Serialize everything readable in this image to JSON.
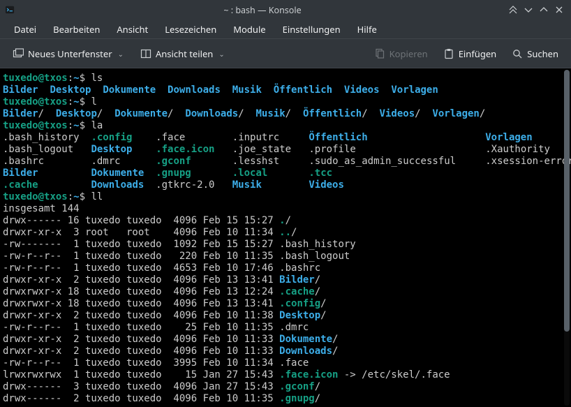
{
  "window": {
    "title": "~ : bash — Konsole"
  },
  "menubar": {
    "items": [
      "Datei",
      "Bearbeiten",
      "Ansicht",
      "Lesezeichen",
      "Module",
      "Einstellungen",
      "Hilfe"
    ]
  },
  "toolbar": {
    "new_tab": "Neues Unterfenster",
    "split_view": "Ansicht teilen",
    "copy": "Kopieren",
    "paste": "Einfügen",
    "search": "Suchen"
  },
  "prompt": {
    "user": "tuxedo",
    "host": "txos",
    "sep": "@",
    "colon": ":",
    "path": "~",
    "dollar": "$ "
  },
  "cmds": {
    "ls": "ls",
    "l": "l",
    "la": "la",
    "ll": "ll"
  },
  "ls_out": [
    "Bilder",
    "Desktop",
    "Dokumente",
    "Downloads",
    "Musik",
    "Öffentlich",
    "Videos",
    "Vorlagen"
  ],
  "l_out": [
    "Bilder",
    "Desktop",
    "Dokumente",
    "Downloads",
    "Musik",
    "Öffentlich",
    "Videos",
    "Vorlagen"
  ],
  "la_grid": {
    "rows": [
      [
        {
          "t": ".bash_history",
          "c": "pl"
        },
        {
          "t": ".config",
          "c": "hidd"
        },
        {
          "t": ".face",
          "c": "pl"
        },
        {
          "t": ".inputrc",
          "c": "pl"
        },
        {
          "t": "Öffentlich",
          "c": "dir"
        },
        {
          "t": "Vorlagen",
          "c": "dir"
        }
      ],
      [
        {
          "t": ".bash_logout",
          "c": "pl"
        },
        {
          "t": "Desktop",
          "c": "dir"
        },
        {
          "t": ".face.icon",
          "c": "hidd"
        },
        {
          "t": ".joe_state",
          "c": "pl"
        },
        {
          "t": ".profile",
          "c": "pl"
        },
        {
          "t": ".Xauthority",
          "c": "pl"
        }
      ],
      [
        {
          "t": ".bashrc",
          "c": "pl"
        },
        {
          "t": ".dmrc",
          "c": "pl"
        },
        {
          "t": ".gconf",
          "c": "hidd"
        },
        {
          "t": ".lesshst",
          "c": "pl"
        },
        {
          "t": ".sudo_as_admin_successful",
          "c": "pl"
        },
        {
          "t": ".xsession-errors",
          "c": "pl"
        }
      ],
      [
        {
          "t": "Bilder",
          "c": "dir"
        },
        {
          "t": "Dokumente",
          "c": "dir"
        },
        {
          "t": ".gnupg",
          "c": "hidd"
        },
        {
          "t": ".local",
          "c": "hidd"
        },
        {
          "t": ".tcc",
          "c": "hidd"
        },
        {
          "t": "",
          "c": "pl"
        }
      ],
      [
        {
          "t": ".cache",
          "c": "hidd"
        },
        {
          "t": "Downloads",
          "c": "dir"
        },
        {
          "t": ".gtkrc-2.0",
          "c": "pl"
        },
        {
          "t": "Musik",
          "c": "dir"
        },
        {
          "t": "Videos",
          "c": "dir"
        },
        {
          "t": "",
          "c": "pl"
        }
      ]
    ],
    "widths": [
      15,
      11,
      13,
      13,
      30,
      17
    ]
  },
  "ll_total": "insgesamt 144",
  "ll_rows": [
    {
      "pre": "drwx------ 16 tuxedo tuxedo  4096 Feb 15 15:27 ",
      "name": ".",
      "cls": "hidd",
      "suf": "/"
    },
    {
      "pre": "drwxr-xr-x  3 root   root    4096 Feb 10 11:34 ",
      "name": "..",
      "cls": "hidd",
      "suf": "/"
    },
    {
      "pre": "-rw-------  1 tuxedo tuxedo  1092 Feb 15 15:27 ",
      "name": ".bash_history",
      "cls": "pl",
      "suf": ""
    },
    {
      "pre": "-rw-r--r--  1 tuxedo tuxedo   220 Feb 10 11:35 ",
      "name": ".bash_logout",
      "cls": "pl",
      "suf": ""
    },
    {
      "pre": "-rw-r--r--  1 tuxedo tuxedo  4653 Feb 10 17:46 ",
      "name": ".bashrc",
      "cls": "pl",
      "suf": ""
    },
    {
      "pre": "drwxr-xr-x  2 tuxedo tuxedo  4096 Feb 13 13:41 ",
      "name": "Bilder",
      "cls": "dir",
      "suf": "/"
    },
    {
      "pre": "drwxrwxr-x 18 tuxedo tuxedo  4096 Feb 13 12:24 ",
      "name": ".cache",
      "cls": "hidd",
      "suf": "/"
    },
    {
      "pre": "drwxrwxr-x 18 tuxedo tuxedo  4096 Feb 13 13:41 ",
      "name": ".config",
      "cls": "hidd",
      "suf": "/"
    },
    {
      "pre": "drwxr-xr-x  2 tuxedo tuxedo  4096 Feb 10 11:38 ",
      "name": "Desktop",
      "cls": "dir",
      "suf": "/"
    },
    {
      "pre": "-rw-r--r--  1 tuxedo tuxedo    25 Feb 10 11:35 ",
      "name": ".dmrc",
      "cls": "pl",
      "suf": ""
    },
    {
      "pre": "drwxr-xr-x  2 tuxedo tuxedo  4096 Feb 10 11:33 ",
      "name": "Dokumente",
      "cls": "dir",
      "suf": "/"
    },
    {
      "pre": "drwxr-xr-x  2 tuxedo tuxedo  4096 Feb 10 11:33 ",
      "name": "Downloads",
      "cls": "dir",
      "suf": "/"
    },
    {
      "pre": "-rw-r--r--  1 tuxedo tuxedo  3995 Feb 10 11:34 ",
      "name": ".face",
      "cls": "pl",
      "suf": ""
    },
    {
      "pre": "lrwxrwxrwx  1 tuxedo tuxedo    15 Jan 27 15:43 ",
      "name": ".face.icon",
      "cls": "hidd",
      "suf": " -> /etc/skel/.face"
    },
    {
      "pre": "drwx------  3 tuxedo tuxedo  4096 Jan 27 15:43 ",
      "name": ".gconf",
      "cls": "hidd",
      "suf": "/"
    },
    {
      "pre": "drwx------  2 tuxedo tuxedo  4096 Feb 10 11:35 ",
      "name": ".gnupg",
      "cls": "hidd",
      "suf": "/"
    }
  ]
}
